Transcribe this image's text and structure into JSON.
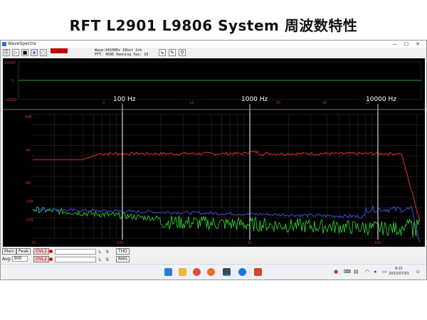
{
  "slide": {
    "title": "RFT L2901 L9806 System 周波数特性"
  },
  "window": {
    "title": "WaveSpectra",
    "minimize": "—",
    "maximize": "☐",
    "close": "✕"
  },
  "toolbar": {
    "wave_info": "Wave:44100Hz 16bit 2ch",
    "fft_info": "FFT: 4096 Hanning",
    "fps_label": "fps:",
    "fps_value": "10"
  },
  "wave": {
    "y_top": "10000",
    "y_mid": "0",
    "y_bot": "-10000",
    "x_ticks": [
      "0",
      "10",
      "15",
      "20",
      "25"
    ]
  },
  "spectrum": {
    "y_ticks": [
      "0dB",
      "-40",
      "-80",
      "-100",
      "-120"
    ],
    "x_ticks": [
      "20",
      "100",
      "1k",
      "10k"
    ],
    "freq_markers": [
      "100 Hz",
      "1000 Hz",
      "10000 Hz"
    ]
  },
  "bottom": {
    "main_label": "Main",
    "peak_label": "Peak",
    "ovl1_label": "OVL1",
    "ovl2_label": "OVL2",
    "avg_label": "Avg:",
    "avg_value": "300",
    "l_label": "L",
    "s_label": "S",
    "thd_label": "THD",
    "rms_label": "RMS"
  },
  "taskbar": {
    "time": "9:21",
    "date": "2023/07/01"
  },
  "colors": {
    "ch1": "#e03030",
    "ch2": "#4050e0",
    "ch3": "#30e030",
    "wave_line": "#28a028",
    "grid": "#3a3a3a"
  }
}
